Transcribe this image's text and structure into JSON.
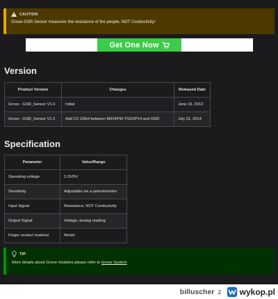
{
  "caution": {
    "icon": "warning-icon",
    "title": "CAUTION",
    "text": "Grove-GSR Sensor measures the resistance of the people, NOT Conductivity!"
  },
  "buy_button": {
    "label": "Get One Now",
    "icon": "cart-icon",
    "color": "#3dcc49"
  },
  "version": {
    "heading": "Version",
    "headers": [
      "Product Version",
      "Changes",
      "Released Date"
    ],
    "rows": [
      [
        "Grove - GSR_Sensor V1.0",
        "Initial",
        "June 19, 2013"
      ],
      [
        "Grove - GSR_Sensor V1.2",
        "Add C3 100nf between M324PW-TSSOP14 and GND",
        "July 31, 2014"
      ]
    ]
  },
  "specification": {
    "heading": "Specification",
    "headers": [
      "Parameter",
      "Value/Range"
    ],
    "rows": [
      [
        "Operating voltage",
        "3.3V/5V"
      ],
      [
        "Sensitivity",
        "Adjustable via a potentiometer"
      ],
      [
        "Input Signal",
        "Resistance, NOT Conductivity"
      ],
      [
        "Output Signal",
        "Voltage, analog reading"
      ],
      [
        "Finger contact material",
        "Nickel"
      ]
    ]
  },
  "tip": {
    "icon": "lightbulb-icon",
    "title": "TIP",
    "text_prefix": "More details about Grove modules please refer to ",
    "link_text": "Grove System"
  },
  "footer": {
    "user": "billuscher",
    "separator": "z",
    "site": "wykop.pl",
    "brand_color": "#1f6fb5"
  }
}
